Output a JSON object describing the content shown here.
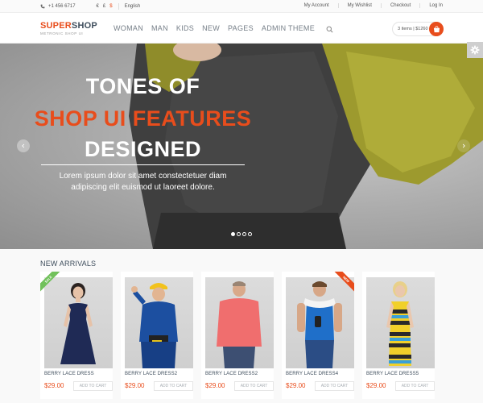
{
  "topbar": {
    "phone": "+1 456 6717",
    "currencies": [
      "€",
      "£",
      "$"
    ],
    "active_currency": "$",
    "language": "English",
    "links": [
      "My Account",
      "My Wishlist",
      "Checkout",
      "Log In"
    ]
  },
  "header": {
    "logo_super": "SUPER",
    "logo_shop": "SHOP",
    "logo_tagline": "METRONIC SHOP UI",
    "nav": [
      "WOMAN",
      "MAN",
      "KIDS",
      "NEW",
      "PAGES",
      "ADMIN THEME"
    ],
    "cart_text": "3 items | $1260"
  },
  "hero": {
    "line1": "TONES OF",
    "line2": "SHOP UI FEATURES",
    "line3": "DESIGNED",
    "sub1": "Lorem ipsum dolor sit amet constectetuer diam",
    "sub2": "adipiscing elit euismod ut laoreet dolore."
  },
  "arrivals": {
    "title": "NEW ARRIVALS",
    "add_label": "ADD TO CART",
    "products": [
      {
        "name": "BERRY LACE DRESS",
        "price": "$29.00",
        "ribbon": "SALE"
      },
      {
        "name": "BERRY LACE DRESS2",
        "price": "$29.00",
        "ribbon": ""
      },
      {
        "name": "BERRY LACE DRESS2",
        "price": "$29.00",
        "ribbon": ""
      },
      {
        "name": "BERRY LACE DRESS4",
        "price": "$29.00",
        "ribbon": "NEW"
      },
      {
        "name": "BERRY LACE DRESS5",
        "price": "$29.00",
        "ribbon": ""
      }
    ]
  },
  "colors": {
    "accent": "#e84d1c",
    "sale_ribbon": "#71c15b",
    "text": "#3e4d5c"
  },
  "icons": [
    "phone-icon",
    "search-icon",
    "shopping-bag-icon",
    "chevron-left-icon",
    "chevron-right-icon",
    "gear-icon"
  ]
}
